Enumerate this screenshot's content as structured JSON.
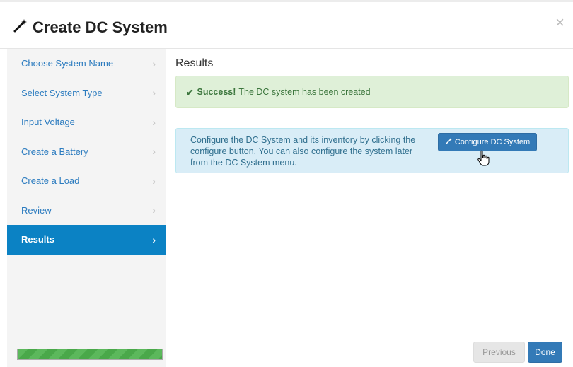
{
  "dialog": {
    "title": "Create DC System",
    "close_glyph": "×"
  },
  "sidebar": {
    "items": [
      {
        "label": "Choose System Name",
        "active": false
      },
      {
        "label": "Select System Type",
        "active": false
      },
      {
        "label": "Input Voltage",
        "active": false
      },
      {
        "label": "Create a Battery",
        "active": false
      },
      {
        "label": "Create a Load",
        "active": false
      },
      {
        "label": "Review",
        "active": false
      },
      {
        "label": "Results",
        "active": true
      }
    ],
    "chevron": "›",
    "progress": 1.0
  },
  "main": {
    "title": "Results",
    "success": {
      "strong": "Success!",
      "message": "The DC system has been created"
    },
    "info": {
      "text": "Configure the DC System and its inventory by clicking the configure button. You can also configure the system later from the DC System menu.",
      "button_label": "Configure DC System"
    }
  },
  "footer": {
    "previous_label": "Previous",
    "done_label": "Done"
  },
  "colors": {
    "accent": "#0b82c4",
    "primary_button": "#337ab7",
    "success_bg": "#dff0d8",
    "info_bg": "#d9edf7"
  },
  "icons": {
    "title": "magic-wand-icon",
    "button": "magic-wand-icon",
    "close": "close-icon",
    "success": "check-icon",
    "cursor": "hand-pointer-icon"
  }
}
